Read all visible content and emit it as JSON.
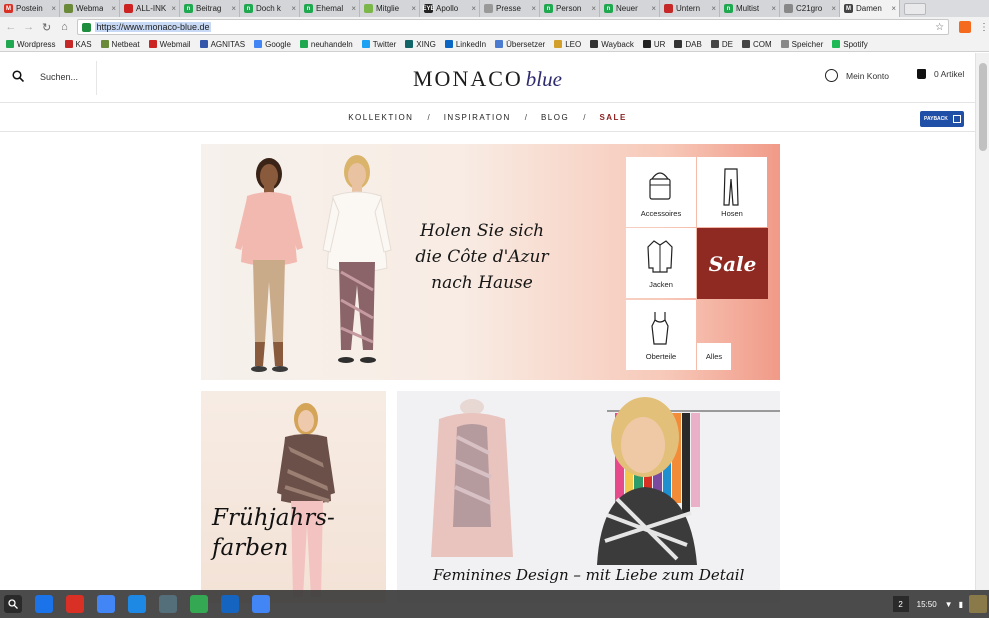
{
  "browser": {
    "tabs": [
      {
        "label": "Postein",
        "favicon_color": "#d93025",
        "favicon_glyph": "M"
      },
      {
        "label": "Webma",
        "favicon_color": "#6a8a3a",
        "favicon_glyph": ""
      },
      {
        "label": "ALL-INK",
        "favicon_color": "#cc2222",
        "favicon_glyph": ""
      },
      {
        "label": "Beitrag",
        "favicon_color": "#1fa84f",
        "favicon_glyph": "n"
      },
      {
        "label": "Doch k",
        "favicon_color": "#1fa84f",
        "favicon_glyph": "n"
      },
      {
        "label": "Ehemal",
        "favicon_color": "#1fa84f",
        "favicon_glyph": "n"
      },
      {
        "label": "Mitglie",
        "favicon_color": "#7ab648",
        "favicon_glyph": ""
      },
      {
        "label": "Apollo",
        "favicon_color": "#222222",
        "favicon_glyph": "EYE"
      },
      {
        "label": "Presse",
        "favicon_color": "#999999",
        "favicon_glyph": ""
      },
      {
        "label": "Person",
        "favicon_color": "#1fa84f",
        "favicon_glyph": "n"
      },
      {
        "label": "Neuer",
        "favicon_color": "#1fa84f",
        "favicon_glyph": "n"
      },
      {
        "label": "Untern",
        "favicon_color": "#c62828",
        "favicon_glyph": ""
      },
      {
        "label": "Multist",
        "favicon_color": "#1fa84f",
        "favicon_glyph": "n"
      },
      {
        "label": "C21gro",
        "favicon_color": "#888888",
        "favicon_glyph": ""
      },
      {
        "label": "Damen",
        "favicon_color": "#444444",
        "favicon_glyph": "M"
      }
    ],
    "active_tab_index": 14,
    "url": "https://www.monaco-blue.de",
    "bookmarks": [
      {
        "label": "Wordpress",
        "color": "#1fa84f"
      },
      {
        "label": "KAS",
        "color": "#c62828"
      },
      {
        "label": "Netbeat",
        "color": "#6a8a3a"
      },
      {
        "label": "Webmail",
        "color": "#cc2222"
      },
      {
        "label": "AGNITAS",
        "color": "#3355aa"
      },
      {
        "label": "Google",
        "color": "#4285f4"
      },
      {
        "label": "neuhandeln",
        "color": "#1fa84f"
      },
      {
        "label": "Twitter",
        "color": "#1da1f2"
      },
      {
        "label": "XING",
        "color": "#126567"
      },
      {
        "label": "LinkedIn",
        "color": "#0a66c2"
      },
      {
        "label": "Übersetzer",
        "color": "#4a7bd0"
      },
      {
        "label": "LEO",
        "color": "#d2a02a"
      },
      {
        "label": "Wayback",
        "color": "#333333"
      },
      {
        "label": "UR",
        "color": "#222222"
      },
      {
        "label": "DAB",
        "color": "#333333"
      },
      {
        "label": "DE",
        "color": "#444444"
      },
      {
        "label": "COM",
        "color": "#444444"
      },
      {
        "label": "Speicher",
        "color": "#888888"
      },
      {
        "label": "Spotify",
        "color": "#1db954"
      }
    ]
  },
  "site": {
    "search_placeholder": "Suchen...",
    "logo_main": "MONACO",
    "logo_script": "blue",
    "account_label": "Mein Konto",
    "cart_label": "0 Artikel",
    "nav": [
      {
        "label": "KOLLEKTION",
        "sale": false
      },
      {
        "label": "INSPIRATION",
        "sale": false
      },
      {
        "label": "BLOG",
        "sale": false
      },
      {
        "label": "SALE",
        "sale": true
      }
    ],
    "nav_separator": "/",
    "payback_label": "PAYBACK",
    "accent_sale": "#8f2a22"
  },
  "hero": {
    "line1": "Holen Sie sich",
    "line2": "die Côte d'Azur",
    "line3": "nach Hause",
    "categories": {
      "accessoires": "Accessoires",
      "hosen": "Hosen",
      "jacken": "Jacken",
      "sale": "Sale",
      "oberteile": "Oberteile",
      "alles": "Alles"
    }
  },
  "promos": {
    "left_line1": "Frühjahrs-",
    "left_line2": "farben",
    "right": "Feminines Design – mit Liebe zum Detail"
  },
  "shelf": {
    "badge": "2",
    "time": "15:50",
    "apps": [
      "#1a73e8",
      "#d93025",
      "#4285f4",
      "#1e88e5",
      "#546e7a",
      "#34a853",
      "#1565c0",
      "#4285f4"
    ]
  }
}
